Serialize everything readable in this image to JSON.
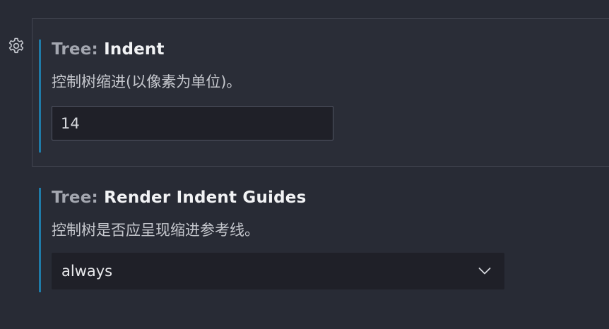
{
  "settings": {
    "indent": {
      "category": "Tree: ",
      "name": "Indent",
      "description": "控制树缩进(以像素为单位)。",
      "value": "14"
    },
    "render_indent_guides": {
      "category": "Tree: ",
      "name": "Render Indent Guides",
      "description": "控制树是否应呈现缩进参考线。",
      "selected": "always"
    }
  },
  "icons": {
    "gear": "gear-icon",
    "chevron": "chevron-down-icon"
  },
  "colors": {
    "background": "#282b35",
    "focus_indicator": "#1f7ba8",
    "input_background": "#1f2028",
    "input_border": "#505462",
    "category_text": "#a4a7b0",
    "title_text": "#f2f3f5",
    "description_text": "#c6c8ce"
  }
}
